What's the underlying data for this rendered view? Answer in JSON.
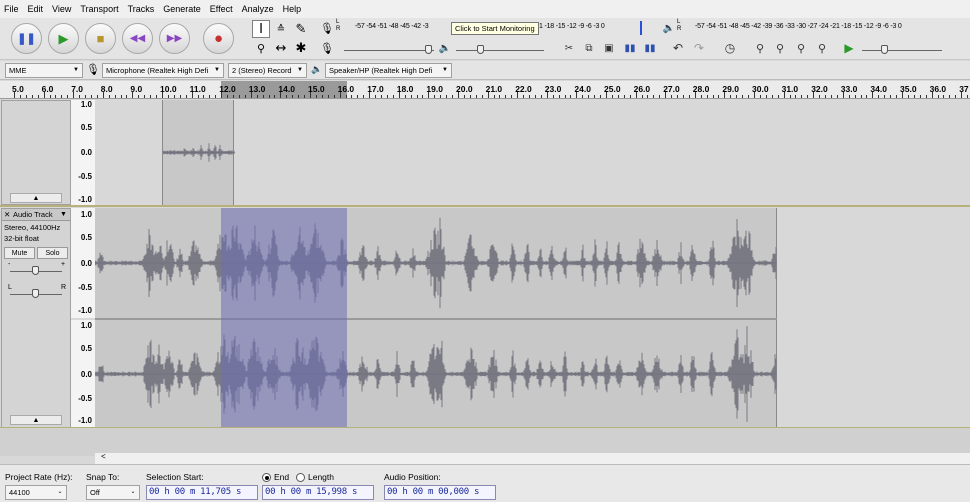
{
  "menu": [
    "File",
    "Edit",
    "View",
    "Transport",
    "Tracks",
    "Generate",
    "Effect",
    "Analyze",
    "Help"
  ],
  "transport": {
    "pause_icon": "pause-icon",
    "play_icon": "play-icon",
    "stop_icon": "stop-icon",
    "skip_start_icon": "skip-to-start-icon",
    "skip_end_icon": "skip-to-end-icon",
    "record_icon": "record-icon"
  },
  "meters": {
    "record_scale": "-57 -54 -51 -48 -45 -42 -3",
    "record_tooltip": "Click to Start Monitoring",
    "record_scale_tail": "1 -18 -15 -12 -9 -6 -3 0",
    "play_scale": "-57 -54 -51 -48 -45 -42 -39 -36 -33 -30 -27 -24 -21 -18 -15 -12 -9 -6 -3 0"
  },
  "device": {
    "host": "MME",
    "input": "Microphone (Realtek High Defi",
    "channels": "2 (Stereo) Record",
    "output": "Speaker/HP (Realtek High Defi"
  },
  "ruler": {
    "labels": [
      "5.0",
      "6.0",
      "7.0",
      "8.0",
      "9.0",
      "10.0",
      "11.0",
      "12.0",
      "13.0",
      "14.0",
      "15.0",
      "16.0",
      "17.0",
      "18.0",
      "19.0",
      "20.0",
      "21.0",
      "22.0",
      "23.0",
      "24.0",
      "25.0",
      "26.0",
      "27.0",
      "28.0",
      "29.0",
      "30.0",
      "31.0",
      "32.0",
      "33.0",
      "34.0",
      "35.0",
      "36.0",
      "37"
    ]
  },
  "tracks": {
    "y_labels": [
      "1.0",
      "0.5",
      "0.0",
      "-0.5",
      "-1.0"
    ],
    "audio_track": {
      "name": "Audio Track",
      "info1": "Stereo, 44100Hz",
      "info2": "32-bit float",
      "mute": "Mute",
      "solo": "Solo",
      "gain_minus": "-",
      "gain_plus": "+",
      "pan_left": "L",
      "pan_right": "R"
    }
  },
  "scroll": {
    "left_arrow": "<"
  },
  "selection_toolbar": {
    "project_rate_label": "Project Rate (Hz):",
    "project_rate": "44100",
    "snap_label": "Snap To:",
    "snap_value": "Off",
    "selection_start_label": "Selection Start:",
    "selection_start": "00 h 00 m 11,705 s",
    "end_label": "End",
    "length_label": "Length",
    "selection_end": "00 h 00 m 15,998 s",
    "audio_position_label": "Audio Position:",
    "audio_position": "00 h 00 m 00,000 s"
  }
}
